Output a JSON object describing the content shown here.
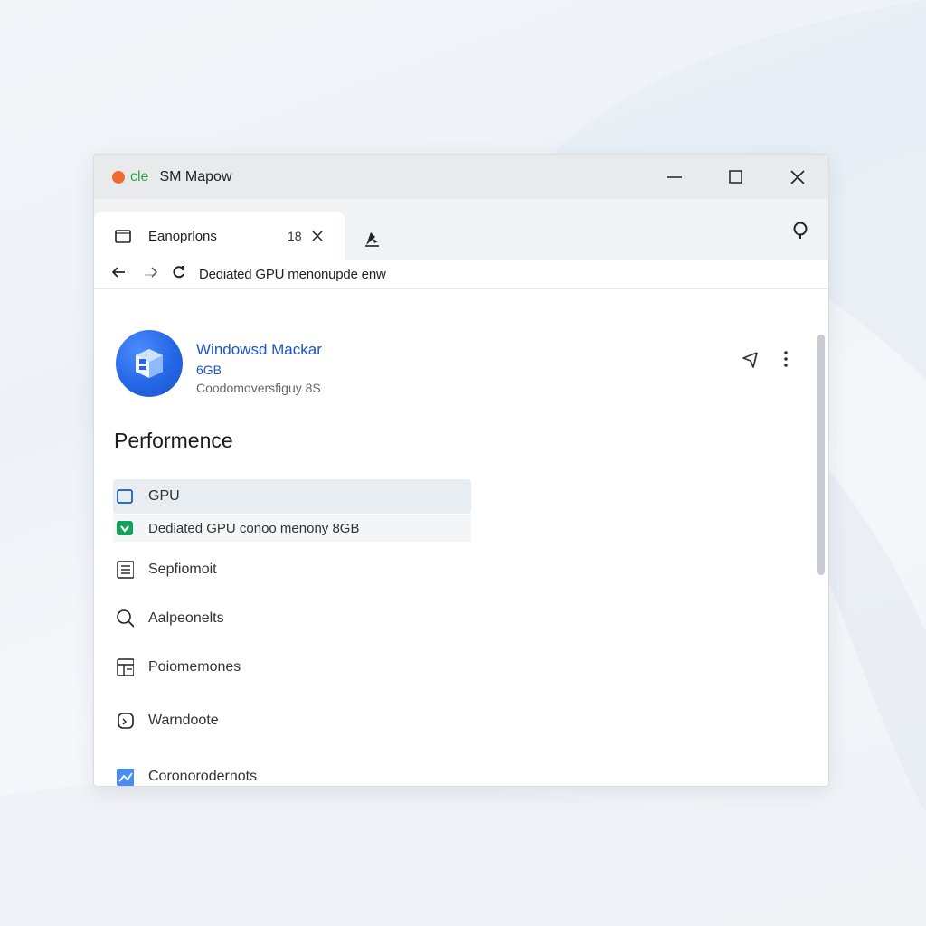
{
  "window": {
    "app_prefix": "cle",
    "title": "SM Mapow"
  },
  "tab": {
    "label": "Eanoprlons",
    "count": "18"
  },
  "address": {
    "text": "Dediated GPU menonupde enw"
  },
  "app": {
    "name": "Windowsd Mackar",
    "size": "6GB",
    "subtitle": "Coodomoversfiguy 8S"
  },
  "section": {
    "title": "Performence"
  },
  "menu": [
    {
      "label": "GPU",
      "icon": "square-outline-icon"
    },
    {
      "label": "Dediated GPU conoo menony 8GB",
      "icon": "check-badge-icon"
    },
    {
      "label": "Sepfiomoit",
      "icon": "document-list-icon"
    },
    {
      "label": "Aalpeonelts",
      "icon": "search-icon"
    },
    {
      "label": "Poiomemones",
      "icon": "panel-grid-icon"
    },
    {
      "label": "Warndoote",
      "icon": "rounded-frame-icon"
    },
    {
      "label": "Coronorodernots",
      "icon": "image-icon"
    }
  ],
  "colors": {
    "accent": "#1a55c8",
    "app_dot": "#f26b2e",
    "prefix_green": "#27a844",
    "check_green": "#12a25a"
  }
}
